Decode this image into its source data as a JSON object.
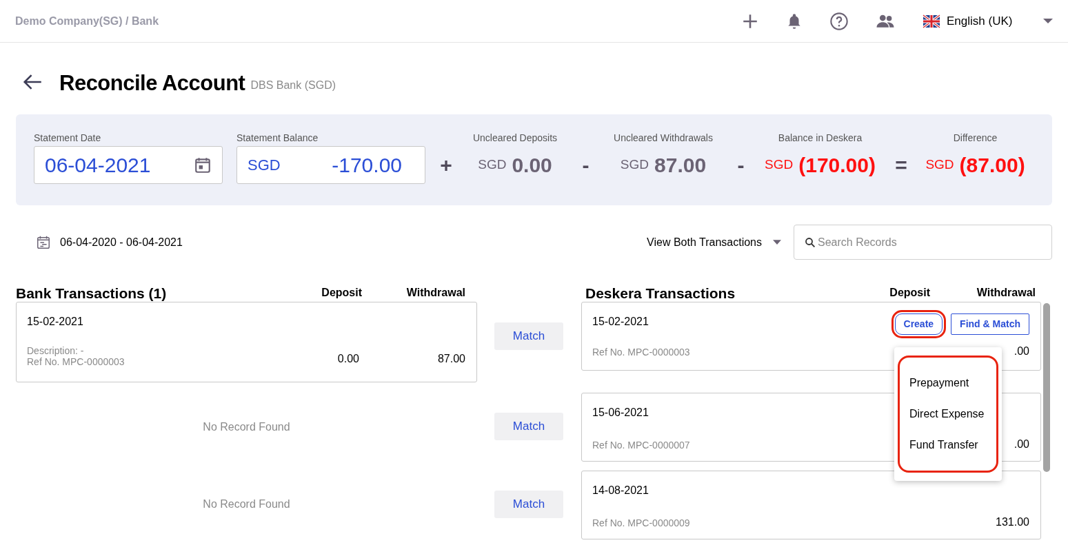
{
  "breadcrumb": "Demo Company(SG) / Bank",
  "language": "English (UK)",
  "page_title": "Reconcile Account",
  "account": "DBS Bank (SGD)",
  "summary": {
    "statement_date": {
      "label": "Statement Date",
      "value": "06-04-2021"
    },
    "statement_balance": {
      "label": "Statement Balance",
      "currency": "SGD",
      "value": "-170.00"
    },
    "items": [
      {
        "operator": "+",
        "label": "Uncleared Deposits",
        "currency": "SGD",
        "value": "0.00",
        "negative": false
      },
      {
        "operator": "-",
        "label": "Uncleared Withdrawals",
        "currency": "SGD",
        "value": "87.00",
        "negative": false
      },
      {
        "operator": "-",
        "label": "Balance in Deskera",
        "currency": "SGD",
        "value": "(170.00)",
        "negative": true
      },
      {
        "operator": "=",
        "label": "Difference",
        "currency": "SGD",
        "value": "(87.00)",
        "negative": true
      }
    ]
  },
  "date_range": "06-04-2020 - 06-04-2021",
  "view_filter": "View Both Transactions",
  "search": {
    "placeholder": "Search Records"
  },
  "bank": {
    "title": "Bank Transactions (1)",
    "columns": [
      "Deposit",
      "Withdrawal"
    ]
  },
  "deskera": {
    "title": "Deskera Transactions",
    "columns": [
      "Deposit",
      "Withdrawal"
    ]
  },
  "rows": [
    {
      "bank": {
        "kind": "record",
        "date": "15-02-2021",
        "description": "Description: -",
        "ref": "Ref No. MPC-0000003",
        "deposit": "0.00",
        "withdrawal": "87.00"
      },
      "match": "Match",
      "deskera": {
        "date": "15-02-2021",
        "ref": "Ref No. MPC-0000003",
        "amount": ".00",
        "actions": [
          {
            "label": "Create",
            "highlighted": true
          },
          {
            "label": "Find & Match",
            "highlighted": false
          }
        ]
      }
    },
    {
      "bank": {
        "kind": "empty",
        "text": "No Record Found"
      },
      "match": "Match",
      "deskera": {
        "date": "15-06-2021",
        "ref": "Ref No. MPC-0000007",
        "amount": ".00"
      }
    },
    {
      "bank": {
        "kind": "empty",
        "text": "No Record Found"
      },
      "match": "Match",
      "deskera": {
        "date": "14-08-2021",
        "ref": "Ref No. MPC-0000009",
        "amount": "131.00"
      }
    }
  ],
  "create_menu": {
    "highlighted": true,
    "items": [
      "Prepayment",
      "Direct Expense",
      "Fund Transfer"
    ]
  }
}
